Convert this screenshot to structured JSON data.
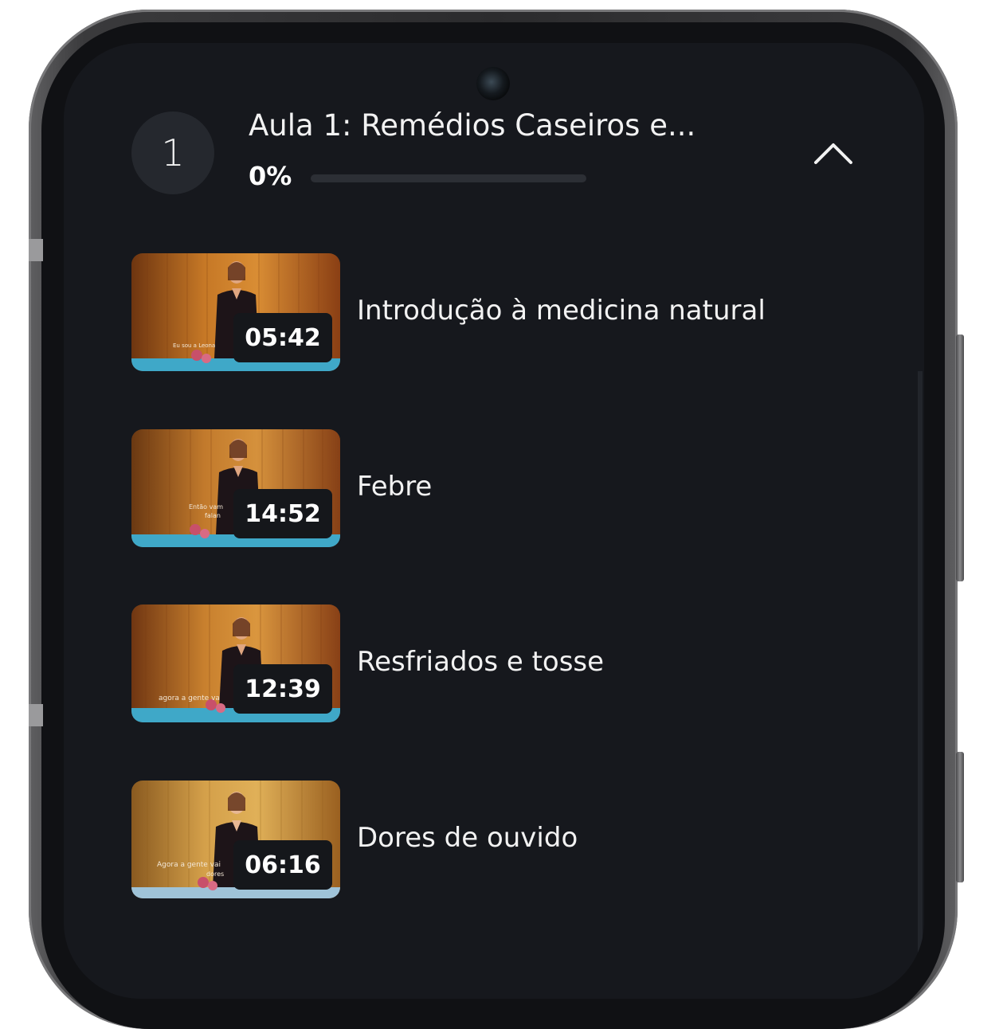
{
  "section": {
    "number": "1",
    "title": "Aula 1: Remédios Caseiros e...",
    "progress_label": "0%",
    "progress": 0,
    "expanded": true,
    "toggle_icon": "chevron-up-icon"
  },
  "lessons": [
    {
      "title": "Introdução à medicina natural",
      "duration": "05:42"
    },
    {
      "title": "Febre",
      "duration": "14:52"
    },
    {
      "title": "Resfriados e tosse",
      "duration": "12:39"
    },
    {
      "title": "Dores de ouvido",
      "duration": "06:16"
    }
  ],
  "colors": {
    "screen_background": "#16181d",
    "number_circle": "#25282e",
    "progress_track": "#2c2f35",
    "duration_badge": "#15171b",
    "text": "#f2f2f2"
  }
}
